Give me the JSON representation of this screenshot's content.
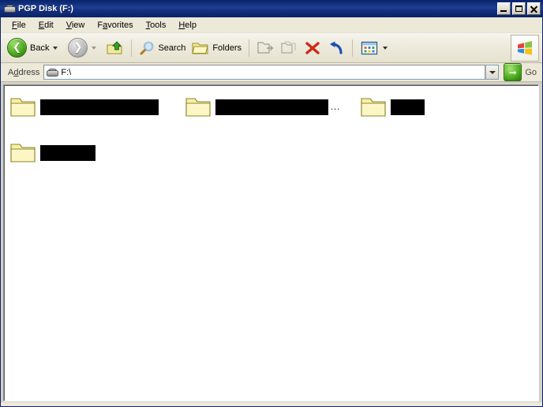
{
  "window": {
    "title": "PGP Disk (F:)",
    "title_icon": "removable-disk-icon",
    "controls": {
      "minimize": "Minimize",
      "maximize": "Maximize",
      "close": "Close"
    }
  },
  "menubar": {
    "items": [
      {
        "label": "File",
        "accel": "F"
      },
      {
        "label": "Edit",
        "accel": "E"
      },
      {
        "label": "View",
        "accel": "V"
      },
      {
        "label": "Favorites",
        "accel": "a"
      },
      {
        "label": "Tools",
        "accel": "T"
      },
      {
        "label": "Help",
        "accel": "H"
      }
    ]
  },
  "toolbar": {
    "back_label": "Back",
    "forward_label": "",
    "up_label": "",
    "search_label": "Search",
    "folders_label": "Folders",
    "moveto_label": "",
    "copyto_label": "",
    "delete_label": "",
    "undo_label": "",
    "views_label": "",
    "windows_logo": "windows-flag-logo"
  },
  "addressbar": {
    "label": "Address",
    "accel": "d",
    "value": "F:\\",
    "icon": "removable-disk-icon",
    "go_label": "Go"
  },
  "content": {
    "view_mode": "tiles",
    "items": [
      {
        "name": "folder-item-1",
        "icon": "folder-icon",
        "label_redacted": true,
        "redact_width": 150,
        "truncated": false
      },
      {
        "name": "folder-item-2",
        "icon": "folder-icon",
        "label_redacted": true,
        "redact_width": 143,
        "truncated": true,
        "ellipsis": "..."
      },
      {
        "name": "folder-item-3",
        "icon": "folder-icon",
        "label_redacted": true,
        "redact_width": 43,
        "truncated": false
      },
      {
        "name": "folder-item-4",
        "icon": "folder-icon",
        "label_redacted": true,
        "redact_width": 70,
        "truncated": false
      }
    ]
  },
  "colors": {
    "titlebar_start": "#0a246a",
    "titlebar_end": "#1c3f94",
    "chrome": "#ece9d8",
    "content_bg": "#ffffff",
    "folder_fill": "#f5efa8",
    "folder_stroke": "#9a8f2e",
    "redaction": "#000000",
    "green_accent": "#4faa1e",
    "delete_red": "#cc2b18",
    "undo_blue": "#1a4fb5"
  }
}
